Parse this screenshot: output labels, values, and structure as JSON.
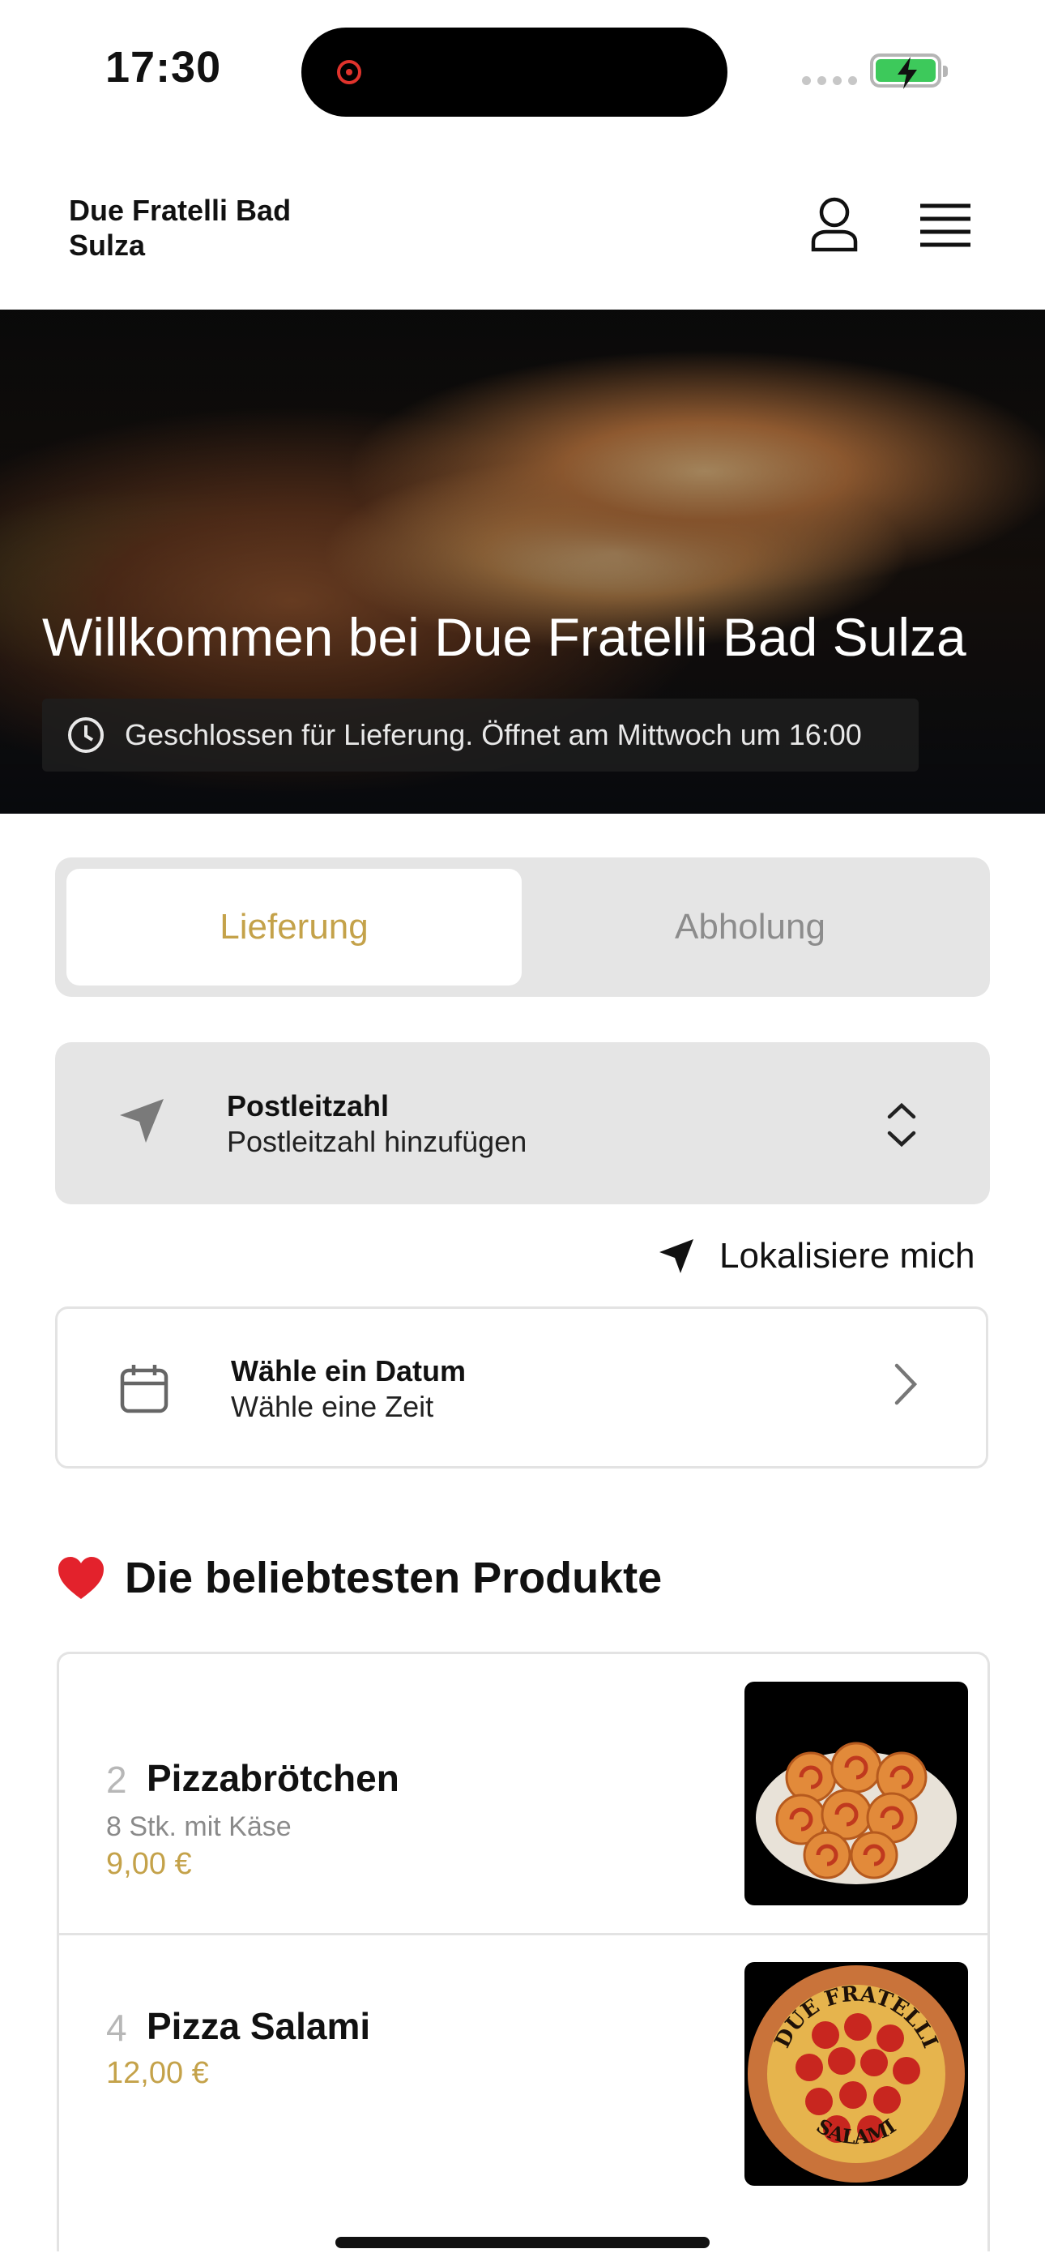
{
  "status_bar": {
    "time": "17:30"
  },
  "header": {
    "brand": "Due Fratelli Bad Sulza"
  },
  "hero": {
    "title": "Willkommen bei Due Fratelli Bad Sulza",
    "status": "Geschlossen für Lieferung. Öffnet am Mittwoch um 16:00"
  },
  "mode_tabs": [
    {
      "label": "Lieferung",
      "selected": true
    },
    {
      "label": "Abholung",
      "selected": false
    }
  ],
  "postal": {
    "title": "Postleitzahl",
    "value": "Postleitzahl hinzufügen"
  },
  "locate": {
    "label": "Lokalisiere mich"
  },
  "schedule": {
    "title": "Wähle ein Datum",
    "subtitle": "Wähle eine Zeit"
  },
  "popular": {
    "title": "Die beliebtesten Produkte",
    "items": [
      {
        "number": "2",
        "name": "Pizzabrötchen",
        "description": "8 Stk. mit Käse",
        "price": "9,00 €"
      },
      {
        "number": "4",
        "name": "Pizza Salami",
        "price": "12,00 €",
        "image_text_top": "DUE FRATELLI",
        "image_text_bottom": "SALAMI"
      }
    ]
  },
  "colors": {
    "accent": "#c4a24a",
    "card_bg": "#e5e5e5"
  }
}
